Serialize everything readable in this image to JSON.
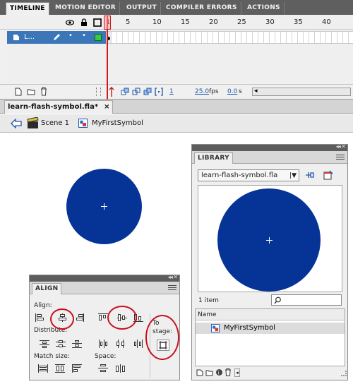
{
  "timeline": {
    "tabs": [
      "TIMELINE",
      "MOTION EDITOR",
      "OUTPUT",
      "COMPILER ERRORS",
      "ACTIONS"
    ],
    "frame_numbers": [
      "5",
      "10",
      "15",
      "20",
      "25",
      "30",
      "35",
      "40"
    ],
    "first_frame": "1",
    "layer_name": "L...",
    "current_frame": "1",
    "fps": "25.0",
    "fps_unit": "fps",
    "time": "0.0",
    "time_unit": "s"
  },
  "document": {
    "tab_label": "learn-flash-symbol.fla*",
    "tab_close": "×"
  },
  "breadcrumb": {
    "scene": "Scene 1",
    "symbol": "MyFirstSymbol"
  },
  "library": {
    "title": "LIBRARY",
    "file_select": "learn-flash-symbol.fla",
    "item_count": "1 item",
    "column_name": "Name",
    "items": [
      "MyFirstSymbol"
    ]
  },
  "align": {
    "title": "ALIGN",
    "align_label": "Align:",
    "distribute_label": "Distribute:",
    "match_size_label": "Match size:",
    "space_label": "Space:",
    "to_stage_label": "To stage:"
  },
  "colors": {
    "symbol_fill": "#063496",
    "highlight_ring": "#c8101e",
    "layer_selected": "#3b76b9"
  }
}
